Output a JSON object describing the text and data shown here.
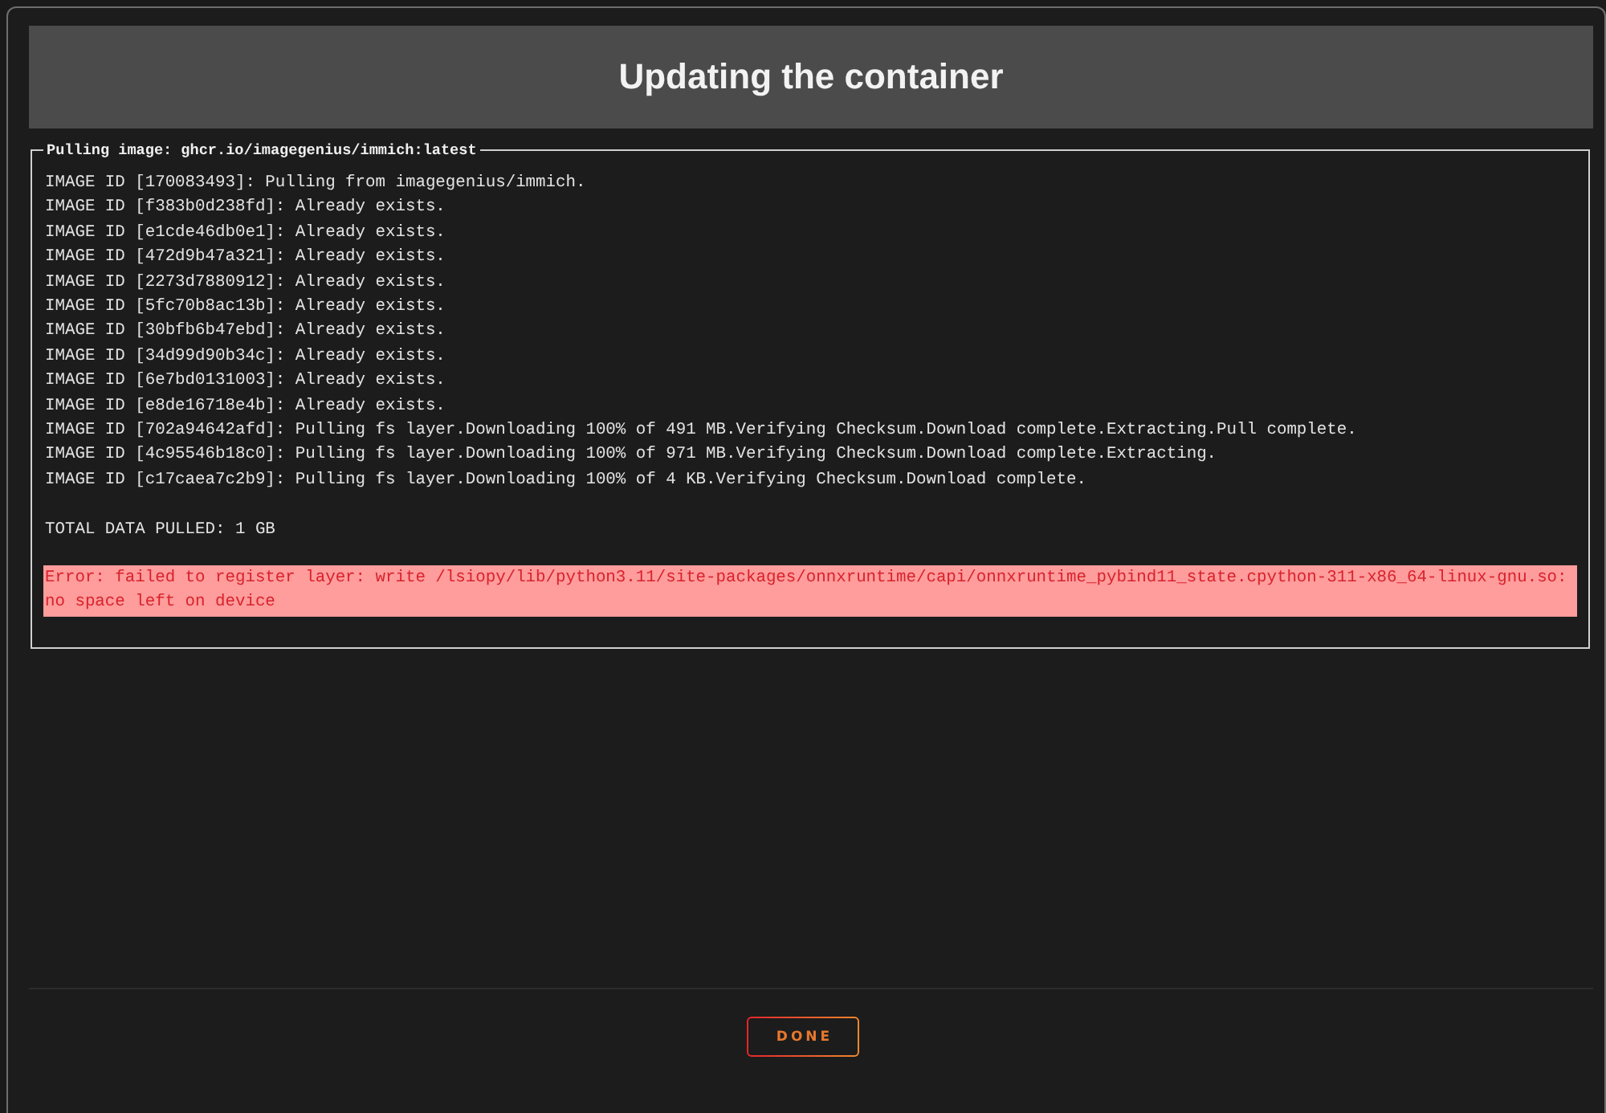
{
  "dialog": {
    "title": "Updating the container"
  },
  "log": {
    "legend": "Pulling image: ghcr.io/imagegenius/immich:latest",
    "lines": [
      "IMAGE ID [170083493]: Pulling from imagegenius/immich.",
      "IMAGE ID [f383b0d238fd]: Already exists.",
      "IMAGE ID [e1cde46db0e1]: Already exists.",
      "IMAGE ID [472d9b47a321]: Already exists.",
      "IMAGE ID [2273d7880912]: Already exists.",
      "IMAGE ID [5fc70b8ac13b]: Already exists.",
      "IMAGE ID [30bfb6b47ebd]: Already exists.",
      "IMAGE ID [34d99d90b34c]: Already exists.",
      "IMAGE ID [6e7bd0131003]: Already exists.",
      "IMAGE ID [e8de16718e4b]: Already exists.",
      "IMAGE ID [702a94642afd]: Pulling fs layer.Downloading 100% of 491 MB.Verifying Checksum.Download complete.Extracting.Pull complete.",
      "IMAGE ID [4c95546b18c0]: Pulling fs layer.Downloading 100% of 971 MB.Verifying Checksum.Download complete.Extracting.",
      "IMAGE ID [c17caea7c2b9]: Pulling fs layer.Downloading 100% of 4 KB.Verifying Checksum.Download complete."
    ],
    "total": "TOTAL DATA PULLED: 1 GB",
    "error": "Error: failed to register layer: write /lsiopy/lib/python3.11/site-packages/onnxruntime/capi/onnxruntime_pybind11_state.cpython-311-x86_64-linux-gnu.so: no space left on device"
  },
  "buttons": [
    {
      "label": "DONE"
    }
  ]
}
